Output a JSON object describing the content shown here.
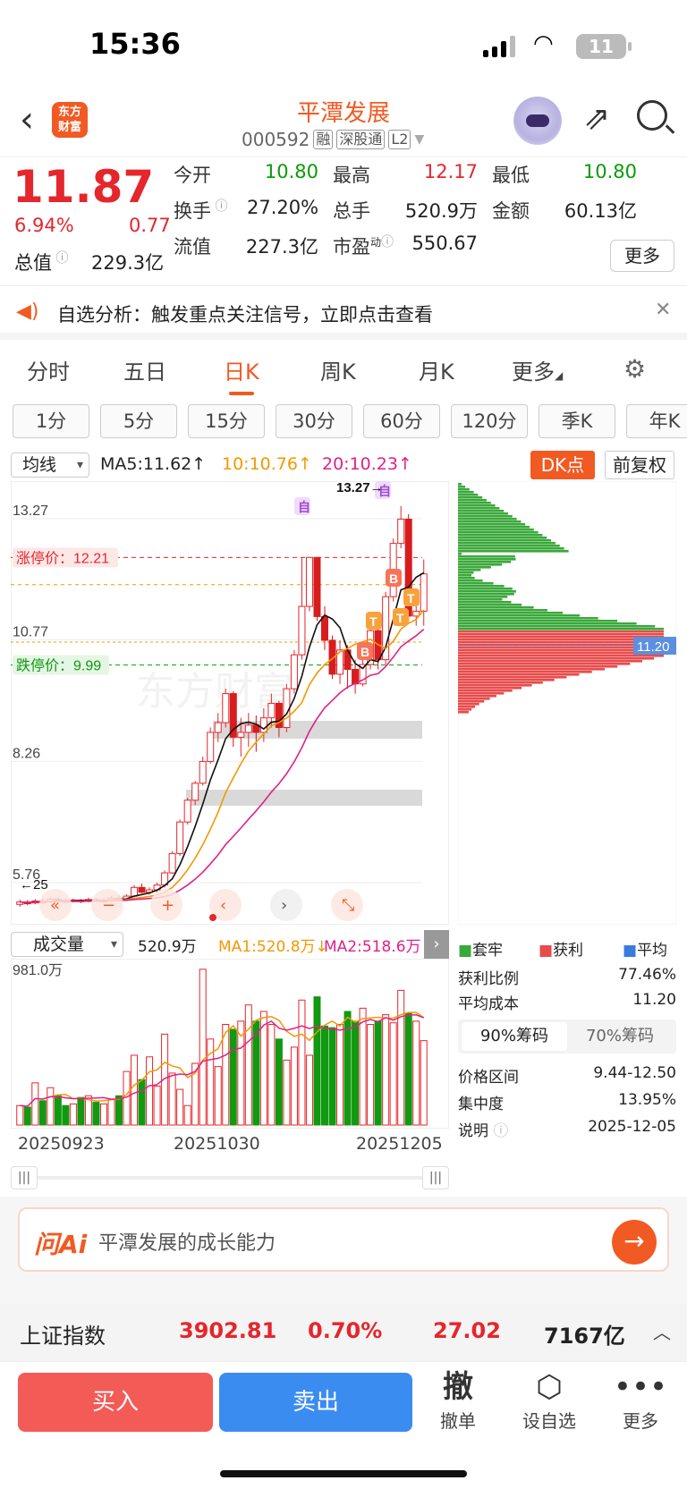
{
  "status_bar": {
    "time": "15:36",
    "battery": "11"
  },
  "header": {
    "logo_text_line1": "东方",
    "logo_text_line2": "财富",
    "stock_name": "平潭发展",
    "stock_code": "000592",
    "tags": [
      "融",
      "深股通",
      "L2"
    ]
  },
  "quote": {
    "price": "11.87",
    "change_pct": "6.94%",
    "change": "0.77",
    "fields": [
      {
        "label": "今开",
        "value": "10.80",
        "color": "green"
      },
      {
        "label": "最高",
        "value": "12.17",
        "color": "red"
      },
      {
        "label": "最低",
        "value": "10.80",
        "color": "green"
      },
      {
        "label": "换手",
        "value": "27.20%",
        "color": "black"
      },
      {
        "label": "总手",
        "value": "520.9万",
        "color": "black"
      },
      {
        "label": "金额",
        "value": "60.13亿",
        "color": "black"
      },
      {
        "label": "流值",
        "value": "227.3亿",
        "color": "black"
      },
      {
        "label": "市盈",
        "value": "550.67",
        "color": "black"
      }
    ],
    "total_value_label": "总值",
    "total_value": "229.3亿",
    "pe_superscript": "动",
    "more_label": "更多"
  },
  "alert": {
    "text": "自选分析：触发重点关注信号，立即点击查看"
  },
  "tabs": [
    "分时",
    "五日",
    "日K",
    "周K",
    "月K",
    "更多"
  ],
  "active_tab": "日K",
  "periods": [
    "1分",
    "5分",
    "15分",
    "30分",
    "60分",
    "120分",
    "季K",
    "年K"
  ],
  "ma_bar": {
    "select": "均线",
    "ma5": "MA5:11.62",
    "ma10": "10:10.76",
    "ma20": "20:10.23",
    "dk_label": "DK点",
    "adjust_label": "前复权"
  },
  "kline": {
    "y_labels": [
      "13.27",
      "10.77",
      "8.26",
      "5.76"
    ],
    "limit_up_label": "涨停价：12.21",
    "limit_down_label": "跌停价：9.99",
    "high_marker": "13.27",
    "ma_left_label": "25",
    "markers": [
      "自",
      "自",
      "B",
      "B",
      "T",
      "T",
      "T"
    ]
  },
  "chips": {
    "avg_cost_label": "11.20"
  },
  "volume_bar": {
    "select": "成交量",
    "vol": "520.9万",
    "ma1": "MA1:520.8万",
    "ma2": "MA2:518.6万",
    "max_label": "981.0万"
  },
  "dates": [
    "20250923",
    "20251030",
    "20251205"
  ],
  "chip_info": {
    "legend": [
      "套牢",
      "获利",
      "平均"
    ],
    "profit_ratio_label": "获利比例",
    "profit_ratio": "77.46%",
    "avg_cost_label": "平均成本",
    "avg_cost": "11.20",
    "tab90": "90%筹码",
    "tab70": "70%筹码",
    "range_label": "价格区间",
    "range": "9.44-12.50",
    "concentration_label": "集中度",
    "concentration": "13.95%",
    "note_label": "说明",
    "note_date": "2025-12-05"
  },
  "ai": {
    "logo": "问Ai",
    "prompt": "平潭发展的成长能力"
  },
  "index_bar": {
    "name": "上证指数",
    "value": "3902.81",
    "pct": "0.70%",
    "change": "27.02",
    "amount": "7167亿"
  },
  "bottom": {
    "buy": "买入",
    "sell": "卖出",
    "cancel": "撤单",
    "cancel_icon": "撤",
    "watch": "设自选",
    "more": "更多"
  },
  "chart_data": {
    "type": "candlestick",
    "ylim": [
      5.0,
      13.6
    ],
    "limit_up": 12.21,
    "limit_down": 9.99,
    "candles": [
      {
        "o": 5.05,
        "c": 5.1,
        "h": 5.15,
        "l": 5.0,
        "v": 120
      },
      {
        "o": 5.1,
        "c": 5.08,
        "h": 5.14,
        "l": 5.03,
        "v": 110
      },
      {
        "o": 5.08,
        "c": 5.12,
        "h": 5.16,
        "l": 5.05,
        "v": 260
      },
      {
        "o": 5.12,
        "c": 5.1,
        "h": 5.18,
        "l": 5.06,
        "v": 150
      },
      {
        "o": 5.1,
        "c": 5.16,
        "h": 5.2,
        "l": 5.08,
        "v": 230
      },
      {
        "o": 5.16,
        "c": 5.13,
        "h": 5.2,
        "l": 5.1,
        "v": 180
      },
      {
        "o": 5.13,
        "c": 5.12,
        "h": 5.18,
        "l": 5.09,
        "v": 120
      },
      {
        "o": 5.12,
        "c": 5.14,
        "h": 5.17,
        "l": 5.1,
        "v": 130
      },
      {
        "o": 5.14,
        "c": 5.11,
        "h": 5.16,
        "l": 5.08,
        "v": 170
      },
      {
        "o": 5.11,
        "c": 5.15,
        "h": 5.19,
        "l": 5.09,
        "v": 180
      },
      {
        "o": 5.15,
        "c": 5.12,
        "h": 5.18,
        "l": 5.1,
        "v": 140
      },
      {
        "o": 5.12,
        "c": 5.14,
        "h": 5.19,
        "l": 5.09,
        "v": 130
      },
      {
        "o": 5.14,
        "c": 5.18,
        "h": 5.22,
        "l": 5.1,
        "v": 160
      },
      {
        "o": 5.18,
        "c": 5.16,
        "h": 5.24,
        "l": 5.13,
        "v": 180
      },
      {
        "o": 5.16,
        "c": 5.22,
        "h": 5.26,
        "l": 5.13,
        "v": 330
      },
      {
        "o": 5.22,
        "c": 5.4,
        "h": 5.45,
        "l": 5.2,
        "v": 430
      },
      {
        "o": 5.4,
        "c": 5.3,
        "h": 5.48,
        "l": 5.28,
        "v": 280
      },
      {
        "o": 5.3,
        "c": 5.35,
        "h": 5.4,
        "l": 5.25,
        "v": 420
      },
      {
        "o": 5.35,
        "c": 5.45,
        "h": 5.5,
        "l": 5.3,
        "v": 240
      },
      {
        "o": 5.45,
        "c": 5.7,
        "h": 5.75,
        "l": 5.4,
        "v": 560
      },
      {
        "o": 5.7,
        "c": 6.1,
        "h": 6.15,
        "l": 5.68,
        "v": 320
      },
      {
        "o": 6.1,
        "c": 6.75,
        "h": 6.8,
        "l": 6.05,
        "v": 220
      },
      {
        "o": 6.75,
        "c": 7.2,
        "h": 7.25,
        "l": 6.7,
        "v": 120
      },
      {
        "o": 7.2,
        "c": 7.55,
        "h": 7.6,
        "l": 7.1,
        "v": 380
      },
      {
        "o": 7.55,
        "c": 8.0,
        "h": 8.1,
        "l": 7.5,
        "v": 960
      },
      {
        "o": 8.0,
        "c": 8.6,
        "h": 8.7,
        "l": 7.95,
        "v": 530
      },
      {
        "o": 8.6,
        "c": 8.8,
        "h": 9.0,
        "l": 8.4,
        "v": 360
      },
      {
        "o": 8.8,
        "c": 9.4,
        "h": 9.5,
        "l": 8.7,
        "v": 620
      },
      {
        "o": 9.4,
        "c": 8.5,
        "h": 9.45,
        "l": 8.3,
        "v": 590
      },
      {
        "o": 8.5,
        "c": 8.6,
        "h": 8.9,
        "l": 8.1,
        "v": 640
      },
      {
        "o": 8.6,
        "c": 8.75,
        "h": 9.0,
        "l": 8.3,
        "v": 740
      },
      {
        "o": 8.75,
        "c": 8.6,
        "h": 8.95,
        "l": 8.2,
        "v": 640
      },
      {
        "o": 8.6,
        "c": 8.9,
        "h": 9.1,
        "l": 8.4,
        "v": 700
      },
      {
        "o": 8.9,
        "c": 9.2,
        "h": 9.4,
        "l": 8.7,
        "v": 620
      },
      {
        "o": 9.2,
        "c": 8.7,
        "h": 9.25,
        "l": 8.5,
        "v": 530
      },
      {
        "o": 8.7,
        "c": 9.5,
        "h": 9.6,
        "l": 8.6,
        "v": 400
      },
      {
        "o": 9.5,
        "c": 10.2,
        "h": 10.3,
        "l": 9.4,
        "v": 480
      },
      {
        "o": 10.2,
        "c": 11.2,
        "h": 12.21,
        "l": 10.1,
        "v": 770
      },
      {
        "o": 11.2,
        "c": 12.21,
        "h": 12.21,
        "l": 11.1,
        "v": 430
      },
      {
        "o": 12.21,
        "c": 10.99,
        "h": 12.21,
        "l": 10.9,
        "v": 790
      },
      {
        "o": 10.99,
        "c": 10.5,
        "h": 11.2,
        "l": 10.3,
        "v": 610
      },
      {
        "o": 10.5,
        "c": 9.8,
        "h": 10.6,
        "l": 9.7,
        "v": 600
      },
      {
        "o": 9.8,
        "c": 10.3,
        "h": 10.5,
        "l": 9.6,
        "v": 620
      },
      {
        "o": 10.3,
        "c": 9.9,
        "h": 10.4,
        "l": 9.5,
        "v": 700
      },
      {
        "o": 9.9,
        "c": 9.6,
        "h": 10.1,
        "l": 9.4,
        "v": 640
      },
      {
        "o": 9.6,
        "c": 10.0,
        "h": 10.2,
        "l": 9.55,
        "v": 720
      },
      {
        "o": 10.0,
        "c": 10.7,
        "h": 10.8,
        "l": 9.9,
        "v": 620
      },
      {
        "o": 10.7,
        "c": 10.1,
        "h": 10.9,
        "l": 9.9,
        "v": 640
      },
      {
        "o": 10.1,
        "c": 11.4,
        "h": 11.5,
        "l": 10.0,
        "v": 680
      },
      {
        "o": 11.4,
        "c": 12.5,
        "h": 12.6,
        "l": 11.3,
        "v": 630
      },
      {
        "o": 12.5,
        "c": 13.0,
        "h": 13.27,
        "l": 12.4,
        "v": 830
      },
      {
        "o": 13.0,
        "c": 11.0,
        "h": 13.1,
        "l": 10.9,
        "v": 690
      },
      {
        "o": 11.0,
        "c": 11.1,
        "h": 11.5,
        "l": 10.8,
        "v": 640
      },
      {
        "o": 11.1,
        "c": 11.87,
        "h": 12.17,
        "l": 10.8,
        "v": 520
      }
    ]
  }
}
